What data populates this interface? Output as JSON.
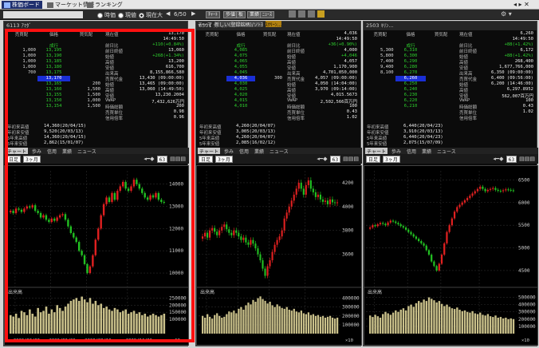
{
  "topbar": {
    "tabs": [
      {
        "label": "株価ボード",
        "active": true
      },
      {
        "label": "マーケット情報",
        "active": false
      },
      {
        "label": "ランキング",
        "active": false
      }
    ]
  },
  "toolbar": {
    "radios": [
      {
        "label": "時価",
        "on": false
      },
      {
        "label": "現値",
        "on": false
      },
      {
        "label": "現在大",
        "on": true
      }
    ],
    "page": "6/50",
    "buttons": [
      "ﾁｬｰﾄ",
      "歩値",
      "板",
      "業績",
      "ﾆｭｰｽ"
    ]
  },
  "panel2": {
    "subtabs": [
      "テーマ",
      "新しい(登録銘柄)/ソﾄﾖ",
      "ｽｸﾘｰﾝ..."
    ]
  },
  "panels": [
    {
      "title": "6113 ｱﾏﾀﾞ",
      "headers": [
        "売買配",
        "価格",
        "買気配"
      ],
      "book_left": [
        "",
        "",
        "1,000",
        "1,000",
        "1,000",
        "1,000",
        "700",
        "",
        "",
        "",
        "",
        "",
        ""
      ],
      "book_price": [
        "",
        "成行",
        "13,195",
        "13,190",
        "13,185",
        "13,180",
        "13,175",
        "13,170",
        "13,165",
        "13,160",
        "13,155",
        "13,150",
        "13,154"
      ],
      "book_right": [
        "",
        "",
        "",
        "",
        "",
        "",
        "",
        "",
        "200",
        "1,500",
        "1,500",
        "1,000",
        "1,500"
      ],
      "current_price": "13,170",
      "info": [
        [
          "現在値",
          "13,170"
        ],
        [
          "",
          "14:49:50"
        ],
        [
          "前日比",
          "+110(+0.84%)"
        ],
        [
          "前日終値",
          "13,060"
        ],
        [
          "始値",
          "+268(+1.34%)"
        ],
        [
          "高値",
          "13,200"
        ],
        [
          "安値",
          "616,700"
        ],
        [
          "出来高",
          "8,155,866,580"
        ],
        [
          "売買代金",
          "13,430 (09:00:00)"
        ],
        [
          "始値",
          "13,465 (09:00:00)"
        ],
        [
          "高値",
          "13,060 (14:49:50)"
        ],
        [
          "安値",
          "13,230.2004"
        ],
        [
          "VWAP",
          "7,432,626万円"
        ],
        [
          "時価総額",
          "200"
        ],
        [
          "売買単位",
          "0.98"
        ],
        [
          "信用倍率",
          "0.96"
        ]
      ],
      "range_rows": [
        [
          "年初来高値",
          "14,360(20/04/15)"
        ],
        [
          "年初来安値",
          "9,520(20/03/13)"
        ],
        [
          "5年来高値",
          "14,360(20/04/15)"
        ],
        [
          "5年来安値",
          "2,862(15/01/07)"
        ]
      ],
      "yearly": "10,288 〜 16,208",
      "chart_tabs": [
        "チャート",
        "歩み",
        "信用",
        "業績",
        "ニュース"
      ],
      "period": "日足",
      "range": "3ヶ月",
      "zoom": "63",
      "volume_label": "出来高",
      "scale": "×10"
    },
    {
      "title": "6501 ｿﾃﾞｨｽ...",
      "headers": [
        "売買配",
        "価格",
        "買気配"
      ],
      "book_left": [
        "",
        "",
        "",
        "",
        "",
        "",
        "",
        "",
        "",
        "",
        "",
        "",
        ""
      ],
      "book_price": [
        "",
        "成行",
        "4,085",
        "4,075",
        "4,065",
        "4,055",
        "4,045",
        "4,036",
        "4,030",
        "4,025",
        "4,020",
        "4,015",
        "4,010"
      ],
      "book_right": [
        "",
        "",
        "",
        "",
        "",
        "",
        "",
        "300",
        "",
        "",
        "",
        "",
        ""
      ],
      "current_price": "4,036",
      "info": [
        [
          "現在値",
          "4,036"
        ],
        [
          "",
          "14:49:50"
        ],
        [
          "前日比",
          "+36(+0.90%)"
        ],
        [
          "前日終値",
          "4,000"
        ],
        [
          "始値",
          "+4,046"
        ],
        [
          "高値",
          "4,057"
        ],
        [
          "安値",
          "1,170,900"
        ],
        [
          "出来高",
          "4,701,050,000"
        ],
        [
          "売買代金",
          "4,057 (09:00:00)"
        ],
        [
          "始値",
          "4,050 (14:04:00)"
        ],
        [
          "高値",
          "3,970 (09:14:00)"
        ],
        [
          "安値",
          "4,015.5673"
        ],
        [
          "VWAP",
          "2,502,566百万円"
        ],
        [
          "時価総額",
          "100"
        ],
        [
          "売買単位",
          "0.43"
        ],
        [
          "信用倍率",
          "1.02"
        ]
      ],
      "range_rows": [
        [
          "年初来高値",
          "4,260(20/04/07)"
        ],
        [
          "年初来安値",
          "3,005(20/03/13)"
        ],
        [
          "5年来高値",
          "4,260(20/04/07)"
        ],
        [
          "5年来安値",
          "2,085(16/02/12)"
        ]
      ],
      "yearly": "3,031 〜 4,701",
      "chart_tabs": [
        "チャート",
        "歩み",
        "信用",
        "業績",
        "ニュース"
      ],
      "period": "日足",
      "range": "3ヶ月",
      "zoom": "63",
      "volume_label": "出来高",
      "scale": "×10"
    },
    {
      "title": "2503 ｷﾘﾝ...",
      "headers": [
        "売買配",
        "価格",
        "買気配"
      ],
      "book_left": [
        "",
        "",
        "5,300",
        "5,800",
        "7,400",
        "9,400",
        "8,100",
        "",
        "",
        "",
        "",
        "",
        ""
      ],
      "book_price": [
        "",
        "成行",
        "6,310",
        "6,300",
        "6,290",
        "6,280",
        "6,270",
        "6,260",
        "6,250",
        "6,240",
        "6,230",
        "6,220",
        "6,210"
      ],
      "book_right": [
        "",
        "",
        "",
        "",
        "",
        "",
        "",
        "",
        "",
        "",
        "",
        "",
        ""
      ],
      "current_price": "6,260",
      "info": [
        [
          "現在値",
          "6,260"
        ],
        [
          "",
          "14:49:50"
        ],
        [
          "前日比",
          "+88(+1.42%)"
        ],
        [
          "前日終値",
          "6,172"
        ],
        [
          "始値",
          "+88(+1.42%)"
        ],
        [
          "高値",
          "268,400"
        ],
        [
          "安値",
          "1,677,766,000"
        ],
        [
          "出来高",
          "6,350 (09:00:00)"
        ],
        [
          "売買代金",
          "6,400 (09:56:00)"
        ],
        [
          "始値",
          "6,200 (14:46:00)"
        ],
        [
          "高値",
          "6,297.8952"
        ],
        [
          "安値",
          "562,007百万円"
        ],
        [
          "VWAP",
          "100"
        ],
        [
          "時価総額",
          "0.43"
        ],
        [
          "売買単位",
          "1.02"
        ],
        [
          "信用倍率",
          ""
        ]
      ],
      "range_rows": [
        [
          "年初来高値",
          "6,440(20/04/23)"
        ],
        [
          "年初来安値",
          "3,910(20/03/13)"
        ],
        [
          "5年来高値",
          "6,440(20/04/23)"
        ],
        [
          "5年来安値",
          "2,075(15/07/09)"
        ]
      ],
      "yearly": "5,380 〜 7,300",
      "chart_tabs": [
        "チャート",
        "歩み",
        "信用",
        "業績",
        "ニュース"
      ],
      "period": "日足",
      "range": "3ヶ月",
      "zoom": "63",
      "volume_label": "出来高",
      "scale": "×10"
    }
  ],
  "chart_data": [
    {
      "type": "candlestick",
      "title": "",
      "x_ticks": [
        "2020/02/03",
        "2020/02/21",
        "2020/03/10",
        "2020/04/01"
      ],
      "y_ticks": [
        10000,
        11000,
        12000,
        13000,
        14000
      ],
      "ylim": [
        9500,
        14600
      ],
      "volume_ticks": [
        100000,
        150000,
        200000,
        250000
      ],
      "volume_ylim": [
        0,
        280000
      ],
      "closes": [
        12800,
        12700,
        12900,
        12850,
        12750,
        12900,
        13000,
        12950,
        13050,
        12800,
        12700,
        12500,
        12600,
        12400,
        12300,
        12450,
        12350,
        12500,
        12600,
        12650,
        12400,
        12100,
        11800,
        11600,
        11400,
        11000,
        10800,
        10400,
        10000,
        10300,
        10800,
        11500,
        12000,
        12600,
        13100,
        13400,
        13200,
        13600,
        13300,
        13700,
        13900,
        14100,
        13800,
        13700,
        13900,
        14200,
        14000,
        13800,
        13600,
        13400,
        13300,
        13500,
        13400,
        13600,
        13300,
        13200,
        13170
      ],
      "volumes": [
        130000,
        120000,
        140000,
        110000,
        160000,
        150000,
        130000,
        170000,
        140000,
        120000,
        180000,
        150000,
        160000,
        190000,
        140000,
        170000,
        150000,
        200000,
        180000,
        160000,
        190000,
        210000,
        230000,
        240000,
        250000,
        230000,
        260000,
        240000,
        220000,
        250000,
        210000,
        230000,
        200000,
        210000,
        180000,
        190000,
        170000,
        160000,
        180000,
        170000,
        150000,
        160000,
        170000,
        140000,
        150000,
        160000,
        140000,
        150000,
        130000,
        140000,
        120000,
        130000,
        140000,
        130000,
        120000,
        130000,
        140000
      ]
    },
    {
      "type": "candlestick",
      "title": "",
      "x_ticks": [],
      "y_ticks": [
        3600,
        3800,
        4000,
        4200
      ],
      "ylim": [
        3350,
        4300
      ],
      "volume_ticks": [
        100000,
        200000,
        300000,
        400000
      ],
      "volume_ylim": [
        0,
        450000
      ],
      "closes": [
        3750,
        3780,
        3740,
        3800,
        3820,
        3790,
        3760,
        3800,
        3830,
        3850,
        3810,
        3780,
        3760,
        3800,
        3780,
        3750,
        3720,
        3740,
        3700,
        3680,
        3720,
        3690,
        3650,
        3600,
        3550,
        3480,
        3420,
        3500,
        3550,
        3620,
        3680,
        3720,
        3750,
        3800,
        3900,
        3950,
        4000,
        4050,
        4100,
        4150,
        4200,
        4150,
        4100,
        4180,
        4220,
        4150,
        4120,
        4080,
        4100,
        4060,
        4040,
        4050,
        4020,
        4060,
        4036,
        4030,
        4036
      ],
      "volumes": [
        200000,
        180000,
        220000,
        190000,
        170000,
        210000,
        230000,
        200000,
        180000,
        190000,
        220000,
        250000,
        240000,
        260000,
        230000,
        280000,
        300000,
        270000,
        320000,
        350000,
        330000,
        380000,
        360000,
        400000,
        420000,
        390000,
        370000,
        340000,
        360000,
        320000,
        300000,
        330000,
        310000,
        290000,
        280000,
        300000,
        270000,
        260000,
        280000,
        250000,
        240000,
        260000,
        230000,
        220000,
        240000,
        210000,
        220000,
        200000,
        210000,
        190000,
        200000,
        180000,
        190000,
        200000,
        180000,
        170000,
        180000
      ]
    },
    {
      "type": "candlestick",
      "title": "",
      "x_ticks": [],
      "y_ticks": [
        4500,
        5000,
        5500,
        6000,
        6500
      ],
      "ylim": [
        4200,
        6700
      ],
      "volume_ticks": [
        100000,
        200000,
        300000,
        400000,
        500000
      ],
      "volume_ylim": [
        0,
        550000
      ],
      "closes": [
        5450,
        5500,
        5480,
        5520,
        5550,
        5530,
        5500,
        5560,
        5600,
        5580,
        5550,
        5520,
        5480,
        5450,
        5400,
        5350,
        5300,
        5250,
        5200,
        5150,
        5100,
        5050,
        4950,
        4850,
        4700,
        4600,
        4500,
        4650,
        4850,
        5100,
        5350,
        5500,
        5650,
        5800,
        5900,
        5950,
        6000,
        6050,
        6100,
        6150,
        6200,
        6250,
        6300,
        6350,
        6300,
        6250,
        6280,
        6300,
        6320,
        6280,
        6260,
        6250,
        6270,
        6290,
        6280,
        6270,
        6260
      ],
      "volumes": [
        250000,
        230000,
        260000,
        240000,
        220000,
        270000,
        300000,
        280000,
        260000,
        290000,
        320000,
        300000,
        330000,
        350000,
        320000,
        380000,
        400000,
        370000,
        420000,
        450000,
        430000,
        470000,
        450000,
        500000,
        480000,
        460000,
        430000,
        450000,
        410000,
        380000,
        400000,
        370000,
        350000,
        340000,
        360000,
        330000,
        310000,
        320000,
        300000,
        290000,
        310000,
        280000,
        270000,
        290000,
        260000,
        250000,
        270000,
        240000,
        230000,
        250000,
        220000,
        230000,
        210000,
        220000,
        200000,
        210000,
        200000
      ]
    }
  ]
}
